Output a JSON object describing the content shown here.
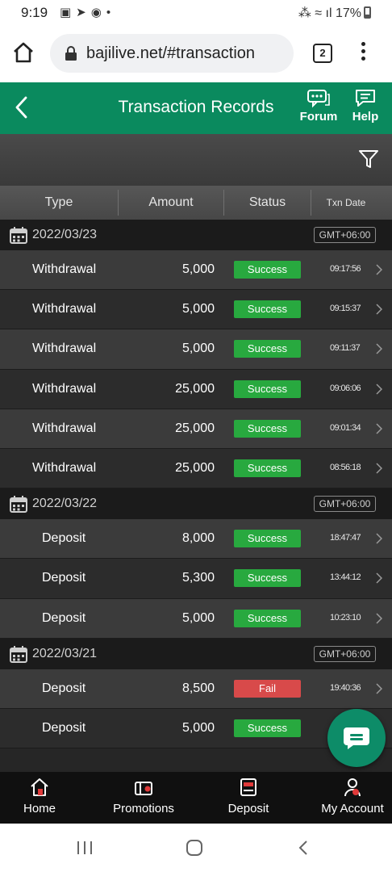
{
  "status_bar": {
    "time": "9:19",
    "battery": "17%"
  },
  "browser": {
    "url": "bajilive.net/#transaction",
    "tab_count": "2"
  },
  "header": {
    "title": "Transaction Records",
    "forum_label": "Forum",
    "help_label": "Help"
  },
  "columns": {
    "type": "Type",
    "amount": "Amount",
    "status": "Status",
    "txn_date": "Txn Date"
  },
  "groups": [
    {
      "date": "2022/03/23",
      "timezone": "GMT+06:00",
      "rows": [
        {
          "type": "Withdrawal",
          "amount": "5,000",
          "status": "Success",
          "time": "09:17:56"
        },
        {
          "type": "Withdrawal",
          "amount": "5,000",
          "status": "Success",
          "time": "09:15:37"
        },
        {
          "type": "Withdrawal",
          "amount": "5,000",
          "status": "Success",
          "time": "09:11:37"
        },
        {
          "type": "Withdrawal",
          "amount": "25,000",
          "status": "Success",
          "time": "09:06:06"
        },
        {
          "type": "Withdrawal",
          "amount": "25,000",
          "status": "Success",
          "time": "09:01:34"
        },
        {
          "type": "Withdrawal",
          "amount": "25,000",
          "status": "Success",
          "time": "08:56:18"
        }
      ]
    },
    {
      "date": "2022/03/22",
      "timezone": "GMT+06:00",
      "rows": [
        {
          "type": "Deposit",
          "amount": "8,000",
          "status": "Success",
          "time": "18:47:47"
        },
        {
          "type": "Deposit",
          "amount": "5,300",
          "status": "Success",
          "time": "13:44:12"
        },
        {
          "type": "Deposit",
          "amount": "5,000",
          "status": "Success",
          "time": "10:23:10"
        }
      ]
    },
    {
      "date": "2022/03/21",
      "timezone": "GMT+06:00",
      "rows": [
        {
          "type": "Deposit",
          "amount": "8,500",
          "status": "Fail",
          "time": "19:40:36"
        },
        {
          "type": "Deposit",
          "amount": "5,000",
          "status": "Success",
          "time": ""
        }
      ]
    }
  ],
  "bottom_nav": [
    {
      "label": "Home",
      "icon": "home-icon"
    },
    {
      "label": "Promotions",
      "icon": "gift-icon"
    },
    {
      "label": "Deposit",
      "icon": "wallet-icon"
    },
    {
      "label": "My Account",
      "icon": "account-icon"
    }
  ],
  "colors": {
    "brand_green": "#0a8a5e",
    "success": "#28a93f",
    "fail": "#d84a4a",
    "list_background": "#262626"
  }
}
